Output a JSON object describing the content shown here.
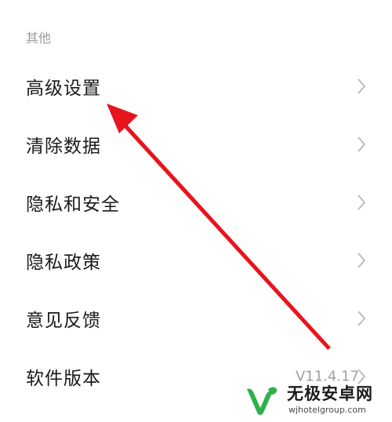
{
  "section": {
    "title": "其他"
  },
  "menu": {
    "items": [
      {
        "label": "高级设置"
      },
      {
        "label": "清除数据"
      },
      {
        "label": "隐私和安全"
      },
      {
        "label": "隐私政策"
      },
      {
        "label": "意见反馈"
      },
      {
        "label": "软件版本",
        "value": "V11.4.17"
      }
    ]
  },
  "annotation": {
    "arrow_color": "#e8141c"
  },
  "watermark": {
    "title": "无极安卓网",
    "url": "wjhotelgroup.com",
    "logo_color": "#2db24a"
  },
  "icons": {
    "chevron": "chevron-right-icon"
  }
}
